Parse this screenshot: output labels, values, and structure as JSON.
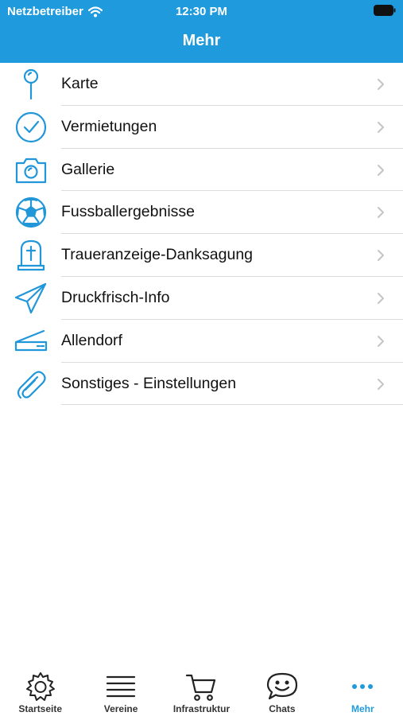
{
  "status_bar": {
    "carrier": "Netzbetreiber",
    "time": "12:30 PM"
  },
  "nav": {
    "title": "Mehr"
  },
  "menu": {
    "items": [
      {
        "label": "Karte",
        "icon": "map-pin-icon"
      },
      {
        "label": "Vermietungen",
        "icon": "checkmark-circle-icon"
      },
      {
        "label": "Gallerie",
        "icon": "camera-icon"
      },
      {
        "label": "Fussballergebnisse",
        "icon": "soccer-ball-icon"
      },
      {
        "label": "Traueranzeige-Danksagung",
        "icon": "gravestone-icon"
      },
      {
        "label": "Druckfrisch-Info",
        "icon": "paper-plane-icon"
      },
      {
        "label": "Allendorf",
        "icon": "scanner-icon"
      },
      {
        "label": "Sonstiges - Einstellungen",
        "icon": "paperclip-icon"
      }
    ]
  },
  "tabbar": {
    "tabs": [
      {
        "label": "Startseite",
        "icon": "gear-icon"
      },
      {
        "label": "Vereine",
        "icon": "list-icon"
      },
      {
        "label": "Infrastruktur",
        "icon": "cart-icon"
      },
      {
        "label": "Chats",
        "icon": "chat-bubble-icon"
      },
      {
        "label": "Mehr",
        "icon": "more-dots-icon",
        "active": true
      }
    ]
  },
  "colors": {
    "accent": "#1f9bdd",
    "icon_blue": "#2196d9",
    "separator": "#dcdcdc",
    "chevron": "#c4c4c7"
  }
}
